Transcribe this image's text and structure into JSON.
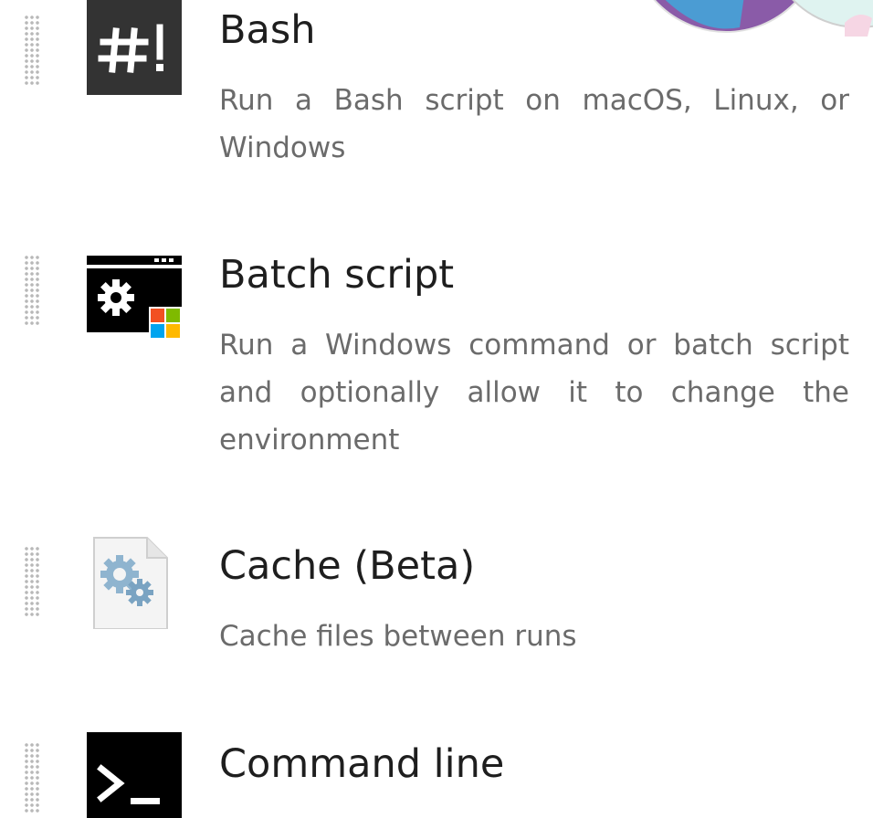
{
  "tasks": [
    {
      "title": "Bash",
      "description": "Run a Bash script on macOS, Linux, or Windows",
      "icon": "hashbang-icon"
    },
    {
      "title": "Batch script",
      "description": "Run a Windows command or batch script and optionally allow it to change the environment",
      "icon": "batch-gear-windows-icon"
    },
    {
      "title": "Cache (Beta)",
      "description": "Cache files between runs",
      "icon": "cache-gears-icon"
    },
    {
      "title": "Command line",
      "description": "",
      "icon": "terminal-prompt-icon"
    }
  ],
  "colors": {
    "title": "#1e1e1e",
    "description": "#6b6b6b",
    "icon_dark": "#333333",
    "icon_black": "#000000",
    "grip": "#b8b8b8"
  }
}
